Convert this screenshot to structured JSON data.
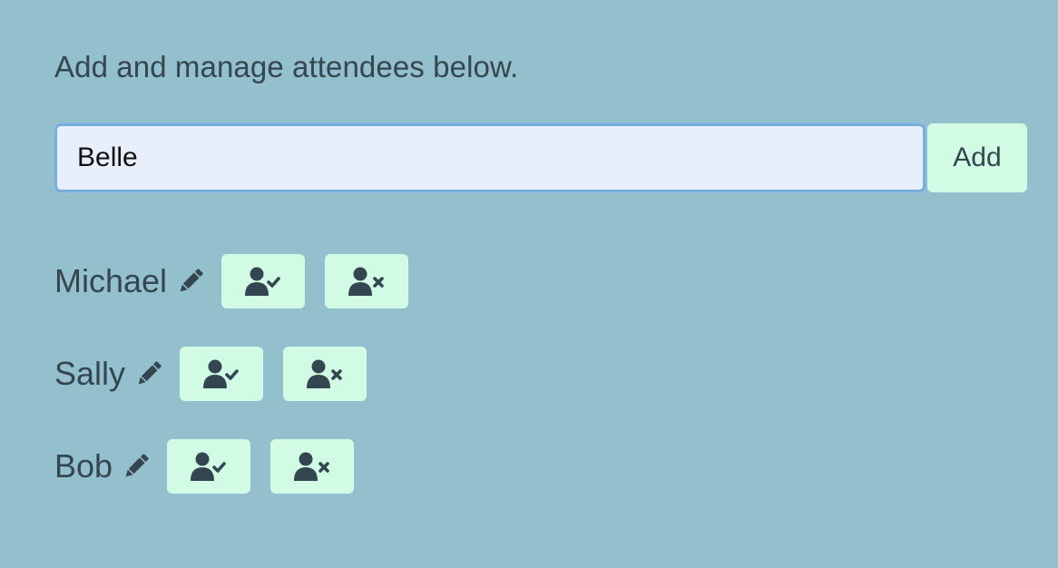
{
  "intro": {
    "text": "Add and manage attendees below."
  },
  "add_form": {
    "input_value": "Belle",
    "button_label": "Add"
  },
  "attendees": [
    {
      "name": "Michael"
    },
    {
      "name": "Sally"
    },
    {
      "name": "Bob"
    }
  ],
  "icons": {
    "edit": "pencil-icon",
    "confirm": "user-check-icon",
    "remove": "user-remove-icon"
  },
  "colors": {
    "background": "#94bfcc",
    "button_background": "#d1fbe5",
    "text": "#34464f",
    "input_background": "#e8effa",
    "input_border": "#79aedb"
  }
}
